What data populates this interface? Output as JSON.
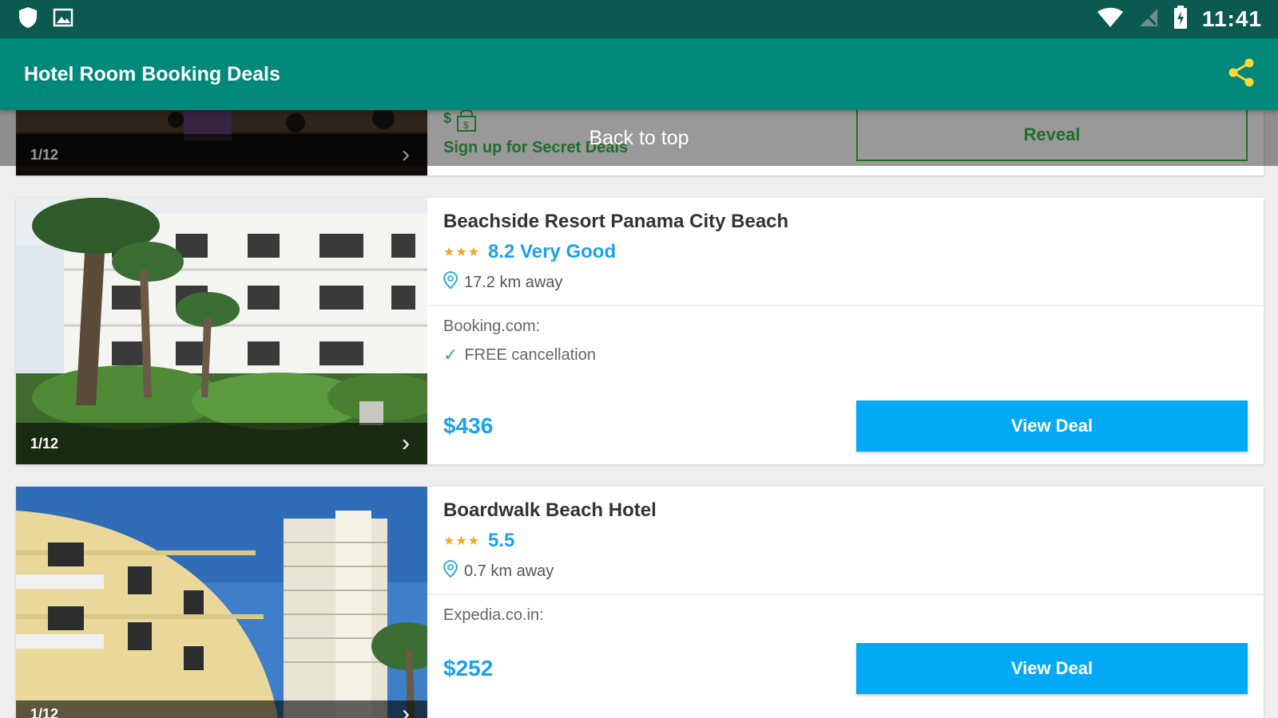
{
  "status_bar": {
    "time": "11:41",
    "left_icons": [
      "shield-icon",
      "image-icon"
    ],
    "right_icons": [
      "wifi-icon",
      "no-signal-icon",
      "battery-charging-icon"
    ]
  },
  "app_bar": {
    "title": "Hotel Room Booking Deals",
    "action_icon": "share-icon",
    "accent_color": "#00897b",
    "share_icon_color": "#fdd835"
  },
  "back_to_top": {
    "label": "Back to top"
  },
  "secret_deal": {
    "image_counter": "1/12",
    "text": "Sign up for Secret Deals",
    "button_label": "Reveal"
  },
  "hotels": [
    {
      "name": "Beachside Resort Panama City Beach",
      "stars": "★★★",
      "rating": "8.2 Very Good",
      "distance": "17.2 km away",
      "provider": "Booking.com:",
      "cancellation": "FREE cancellation",
      "price": "$436",
      "button_label": "View Deal",
      "image_counter": "1/12"
    },
    {
      "name": "Boardwalk Beach Hotel",
      "stars": "★★★",
      "rating": "5.5",
      "distance": "0.7 km away",
      "provider": "Expedia.co.in:",
      "price": "$252",
      "button_label": "View Deal",
      "image_counter": "1/12"
    }
  ],
  "colors": {
    "price": "#1aa3e8",
    "button": "#03a9f4",
    "secret_green": "#3ab54a",
    "star": "#f5a623"
  }
}
